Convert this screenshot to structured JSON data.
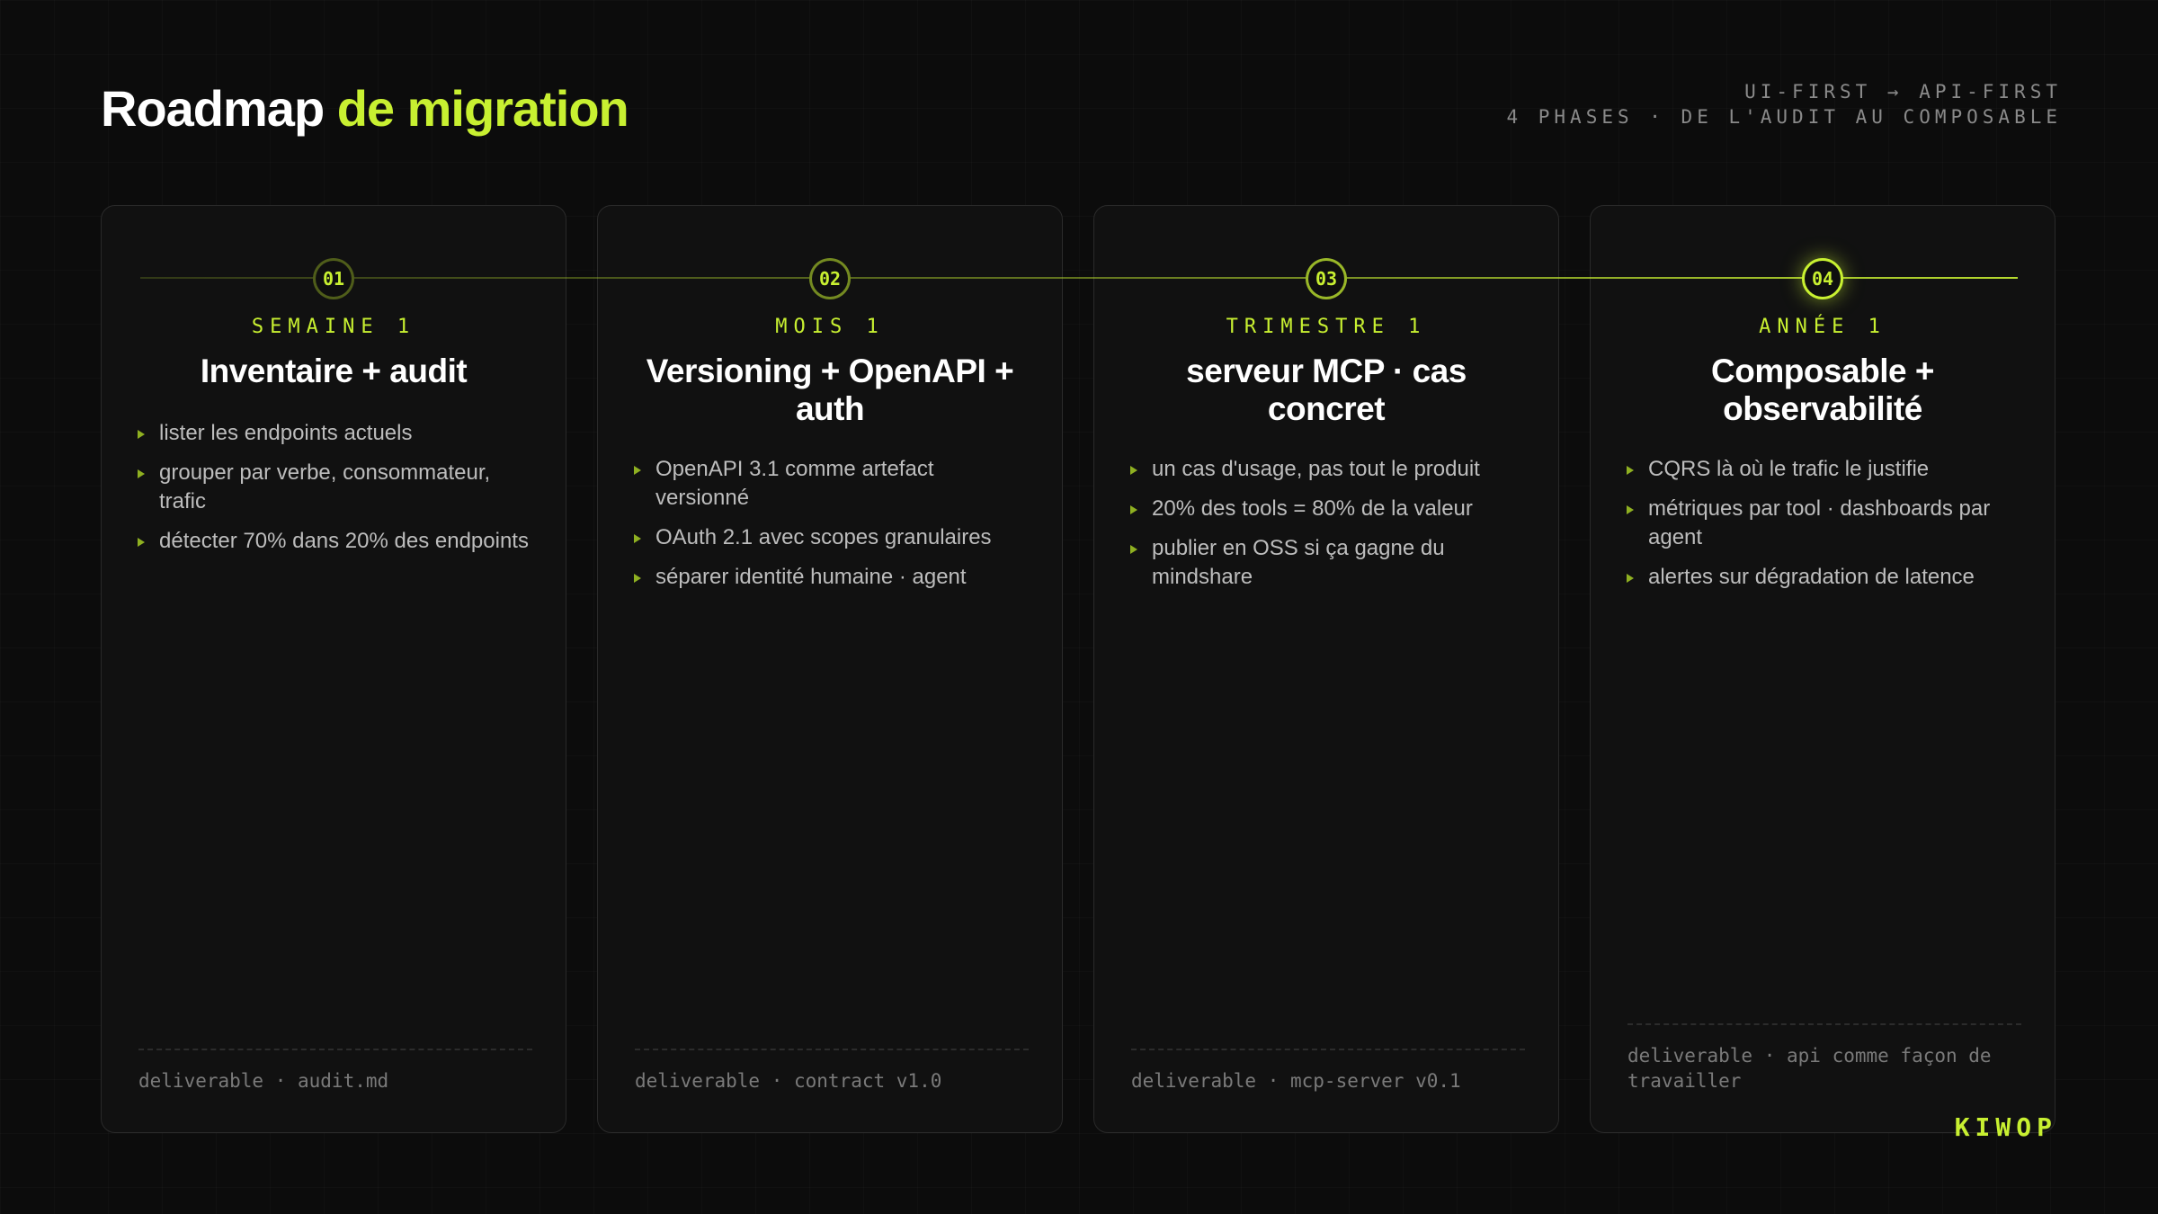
{
  "header": {
    "title_part1": "Roadmap",
    "title_part2": "de migration",
    "meta_line1": "UI-FIRST → API-FIRST",
    "meta_line2": "4 PHASES · DE L'AUDIT AU COMPOSABLE"
  },
  "phases": [
    {
      "number": "01",
      "label": "SEMAINE 1",
      "title": "Inventaire + audit",
      "items": [
        "lister les endpoints actuels",
        "grouper par verbe, consommateur, trafic",
        "détecter 70% dans 20% des endpoints"
      ],
      "deliverable": "deliverable · audit.md"
    },
    {
      "number": "02",
      "label": "MOIS 1",
      "title": "Versioning + OpenAPI + auth",
      "items": [
        "OpenAPI 3.1 comme artefact versionné",
        "OAuth 2.1 avec scopes granulaires",
        "séparer identité humaine · agent"
      ],
      "deliverable": "deliverable · contract v1.0"
    },
    {
      "number": "03",
      "label": "TRIMESTRE 1",
      "title": "serveur MCP · cas concret",
      "items": [
        "un cas d'usage, pas tout le produit",
        "20% des tools = 80% de la valeur",
        "publier en OSS si ça gagne du mindshare"
      ],
      "deliverable": "deliverable · mcp-server v0.1"
    },
    {
      "number": "04",
      "label": "ANNÉE 1",
      "title": "Composable + observabilité",
      "items": [
        "CQRS là où le trafic le justifie",
        "métriques par tool · dashboards par agent",
        "alertes sur dégradation de latence"
      ],
      "deliverable": "deliverable · api comme façon de travailler"
    }
  ],
  "brand": "KIWOP",
  "colors": {
    "accent": "#c8f031",
    "background": "#0c0c0c",
    "card": "#111111"
  }
}
